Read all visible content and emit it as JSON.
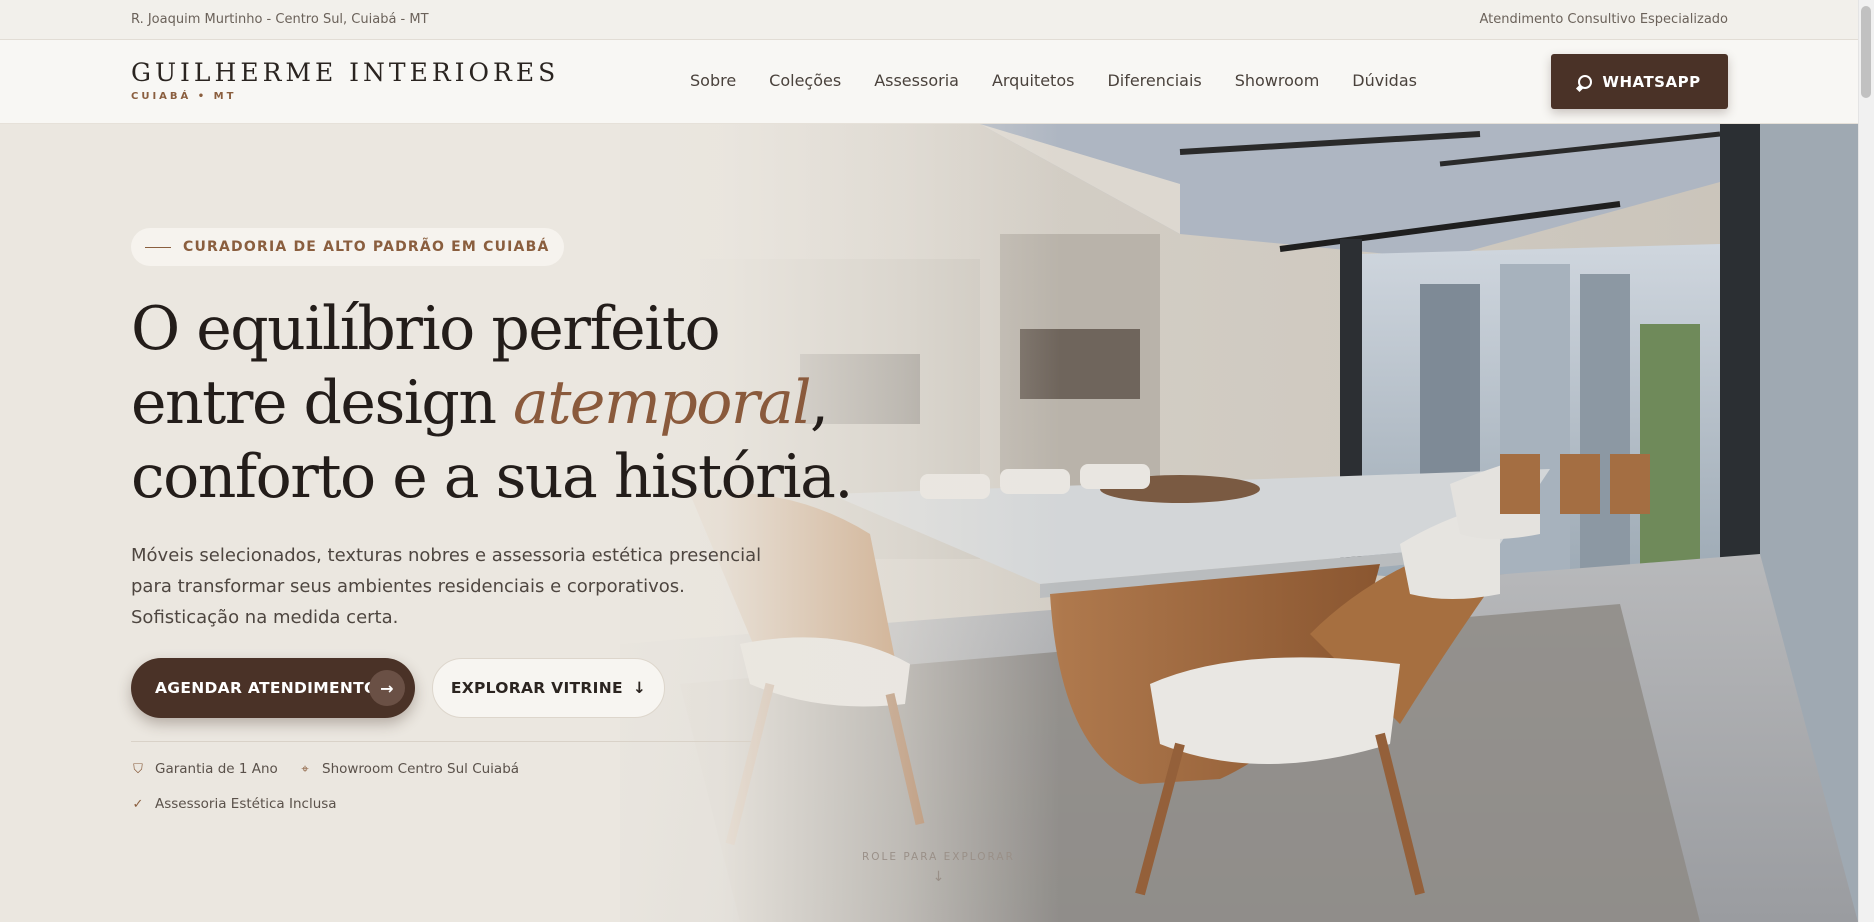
{
  "topbar": {
    "address": "R. Joaquim Murtinho - Centro Sul, Cuiabá - MT",
    "service": "Atendimento Consultivo Especializado"
  },
  "brand": {
    "name": "GUILHERME INTERIORES",
    "sub": "CUIABÁ • MT"
  },
  "nav": {
    "items": [
      "Sobre",
      "Coleções",
      "Assessoria",
      "Arquitetos",
      "Diferenciais",
      "Showroom",
      "Dúvidas"
    ]
  },
  "header": {
    "whatsapp_label": "WHATSAPP",
    "whatsapp_icon": "chat-bubble-icon"
  },
  "hero": {
    "tag": "CURADORIA DE ALTO PADRÃO EM CUIABÁ",
    "headline_line1": "O equilíbrio perfeito",
    "headline_line2_pre": "entre design ",
    "headline_line2_em": "atemporal",
    "headline_line2_post": ",",
    "headline_line3": "conforto e a sua história.",
    "lead": "Móveis selecionados, texturas nobres e assessoria estética presencial para transformar seus ambientes residenciais e corporativos. Sofisticação na medida certa.",
    "primary_label": "AGENDAR ATENDIMENTO",
    "primary_icon": "→",
    "secondary_label": "EXPLORAR VITRINE",
    "secondary_icon": "↓",
    "features": [
      {
        "icon": "shield-icon",
        "label": "Garantia de 1 Ano"
      },
      {
        "icon": "map-pin-icon",
        "label": "Showroom Centro Sul Cuiabá"
      },
      {
        "icon": "check-icon",
        "label": "Assessoria Estética Inclusa"
      }
    ],
    "scroll_hint": "ROLE PARA EXPLORAR",
    "scroll_icon": "↓",
    "colors": {
      "accent": "#8a5e3e",
      "dark": "#4a3227",
      "background": "#ebe7e0"
    }
  }
}
